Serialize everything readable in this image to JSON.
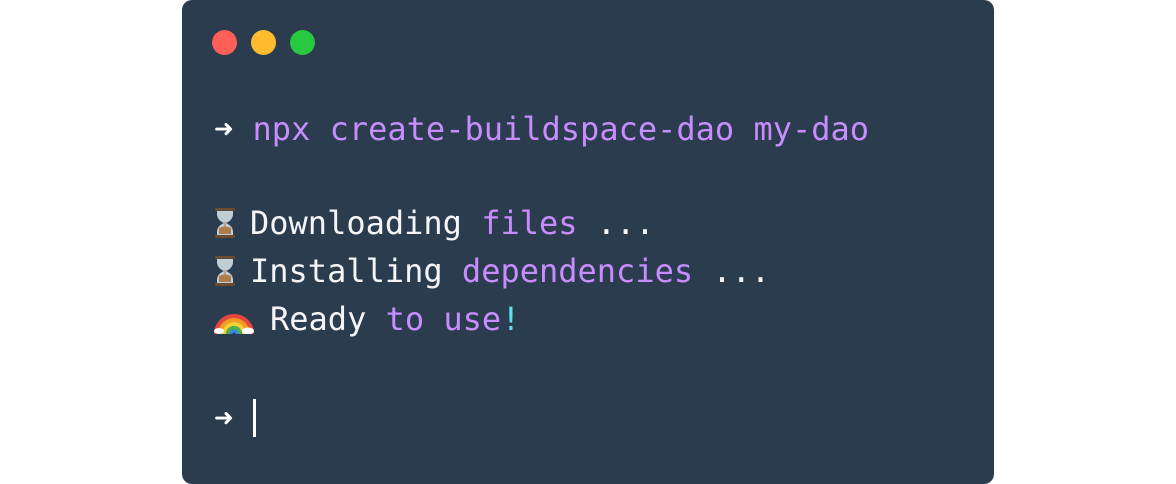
{
  "window": {
    "controls": {
      "close_color": "#ff5f57",
      "minimize_color": "#febc2e",
      "maximize_color": "#28c840"
    }
  },
  "terminal": {
    "prompt_symbol": "➜",
    "command": "npx create-buildspace-dao my-dao",
    "output": [
      {
        "icon": "hourglass-icon",
        "text": "Downloading",
        "highlight": "files",
        "suffix": " ..."
      },
      {
        "icon": "hourglass-icon",
        "text": "Installing",
        "highlight": "dependencies",
        "suffix": " ..."
      },
      {
        "icon": "rainbow-icon",
        "text": "Ready",
        "highlight": "to use",
        "suffix": "!"
      }
    ],
    "final_prompt_symbol": "➜"
  },
  "colors": {
    "background": "#2b3c4e",
    "text": "#f5f5f7",
    "accent": "#c78dff",
    "exclamation": "#5ee0f0"
  }
}
